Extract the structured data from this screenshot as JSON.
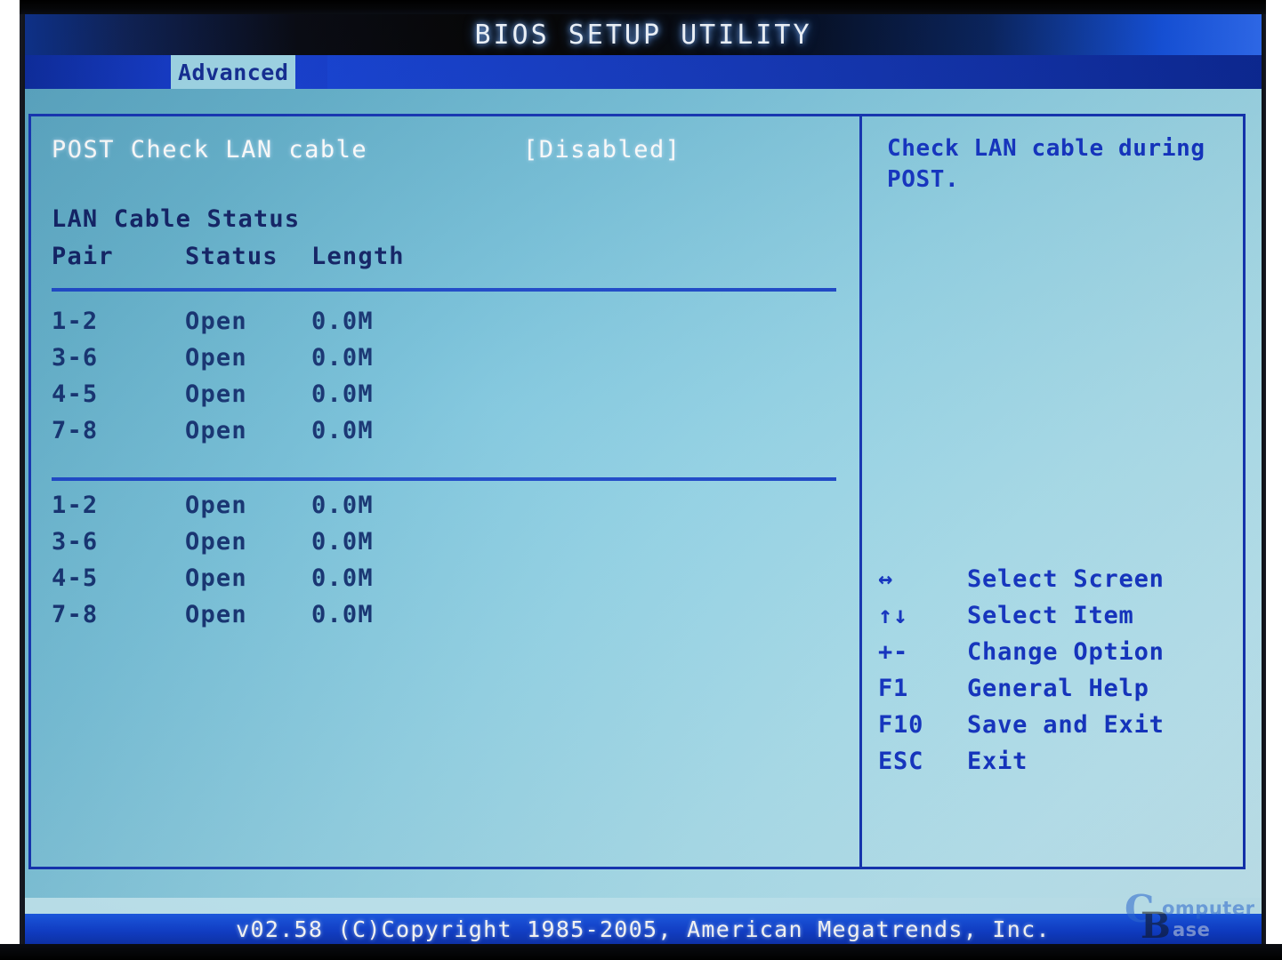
{
  "titlebar": {
    "title": "BIOS SETUP UTILITY"
  },
  "tabs": [
    {
      "label": "Advanced",
      "active": true
    }
  ],
  "main": {
    "option": {
      "label": "POST Check LAN cable",
      "value": "[Disabled]"
    },
    "section_title": "LAN Cable Status",
    "columns": {
      "pair": "Pair",
      "status": "Status",
      "length": "Length"
    },
    "blocks": [
      {
        "rows": [
          {
            "pair": "1-2",
            "status": "Open",
            "length": "0.0M"
          },
          {
            "pair": "3-6",
            "status": "Open",
            "length": "0.0M"
          },
          {
            "pair": "4-5",
            "status": "Open",
            "length": "0.0M"
          },
          {
            "pair": "7-8",
            "status": "Open",
            "length": "0.0M"
          }
        ]
      },
      {
        "rows": [
          {
            "pair": "1-2",
            "status": "Open",
            "length": "0.0M"
          },
          {
            "pair": "3-6",
            "status": "Open",
            "length": "0.0M"
          },
          {
            "pair": "4-5",
            "status": "Open",
            "length": "0.0M"
          },
          {
            "pair": "7-8",
            "status": "Open",
            "length": "0.0M"
          }
        ]
      }
    ]
  },
  "help": {
    "text": "Check LAN cable during POST.",
    "keys": [
      {
        "glyph": "↔",
        "icon": "left-right-arrow-icon",
        "desc": "Select Screen"
      },
      {
        "glyph": "↑↓",
        "icon": "up-down-arrow-icon",
        "desc": "Select Item"
      },
      {
        "glyph": "+-",
        "icon": "plus-minus-icon",
        "desc": "Change Option"
      },
      {
        "glyph": "F1",
        "icon": "f1-key-icon",
        "desc": "General Help"
      },
      {
        "glyph": "F10",
        "icon": "f10-key-icon",
        "desc": "Save and Exit"
      },
      {
        "glyph": "ESC",
        "icon": "esc-key-icon",
        "desc": "Exit"
      }
    ]
  },
  "footer": {
    "text": "v02.58 (C)Copyright 1985-2005, American Megatrends, Inc."
  },
  "watermark": {
    "c": "C",
    "b": "B",
    "omputer": "omputer",
    "ase": "ase"
  },
  "colors": {
    "title_bar_blue": "#1452e0",
    "tab_active_bg": "#9fd7e8",
    "tab_active_text": "#102a93",
    "panel_border": "#1333b4",
    "selected_text": "#ffffff",
    "body_text": "#123070",
    "help_text": "#1233c4",
    "footer_bg": "#0f3fcf",
    "screen_bg_dark": "#59a6c3",
    "screen_bg_light": "#c6ecf6"
  }
}
